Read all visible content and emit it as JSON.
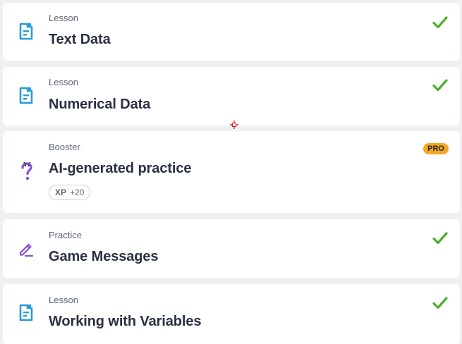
{
  "items": [
    {
      "type": "Lesson",
      "title": "Text Data",
      "icon": "lesson-document-icon",
      "completed": true
    },
    {
      "type": "Lesson",
      "title": "Numerical Data",
      "icon": "lesson-document-icon",
      "completed": true
    },
    {
      "type": "Booster",
      "title": "AI-generated practice",
      "icon": "question-mark-icon",
      "badge": "PRO",
      "xp_label": "XP",
      "xp_value": "+20"
    },
    {
      "type": "Practice",
      "title": "Game Messages",
      "icon": "pencil-edit-icon",
      "completed": true
    },
    {
      "type": "Lesson",
      "title": "Working with Variables",
      "icon": "lesson-document-icon",
      "completed": true
    }
  ],
  "colors": {
    "lesson_icon": "#2a9bd8",
    "practice_icon": "#8a4fd6",
    "check": "#4caf2a",
    "pro_badge": "#f5a623",
    "background": "#eef0f4",
    "card": "#ffffff"
  }
}
